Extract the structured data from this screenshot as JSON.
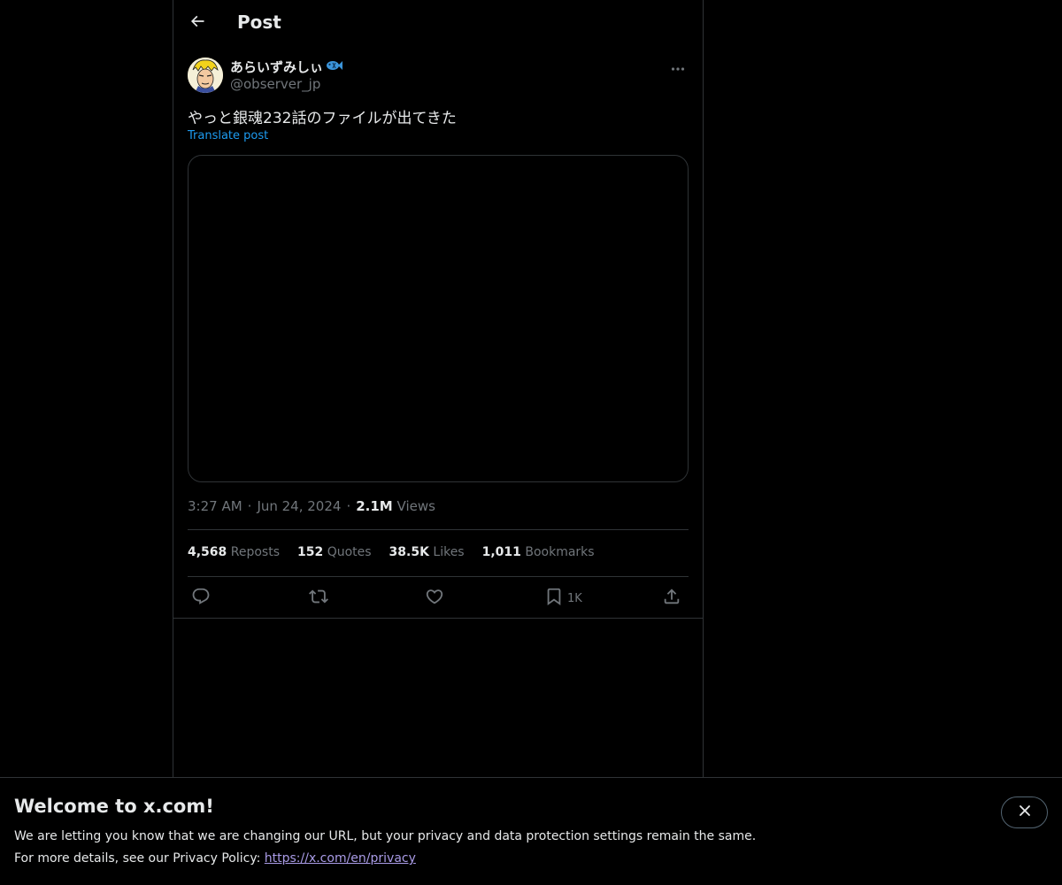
{
  "header": {
    "title": "Post",
    "back_icon": "arrow-left-icon"
  },
  "post": {
    "author": {
      "display_name": "あらいずみしぃ",
      "emoji_icon": "fish-icon",
      "handle": "@observer_jp"
    },
    "text": "やっと銀魂232話のファイルが出てきた",
    "translate_label": "Translate post",
    "time": "3:27 AM",
    "date": "Jun 24, 2024",
    "views_count": "2.1M",
    "views_label": "Views",
    "separator": "·"
  },
  "stats": {
    "reposts_count": "4,568",
    "reposts_label": "Reposts",
    "quotes_count": "152",
    "quotes_label": "Quotes",
    "likes_count": "38.5K",
    "likes_label": "Likes",
    "bookmarks_count": "1,011",
    "bookmarks_label": "Bookmarks"
  },
  "actions": {
    "reply_icon": "reply-icon",
    "repost_icon": "repost-icon",
    "like_icon": "heart-icon",
    "bookmark_icon": "bookmark-icon",
    "bookmark_count": "1K",
    "share_icon": "share-icon"
  },
  "banner": {
    "title": "Welcome to x.com!",
    "line1": "We are letting you know that we are changing our URL, but your privacy and data protection settings remain the same.",
    "line2_prefix": "For more details, see our Privacy Policy: ",
    "link": "https://x.com/en/privacy",
    "close_icon": "close-icon"
  },
  "colors": {
    "background": "#000000",
    "text": "#e7e9ea",
    "muted": "#71767b",
    "accent": "#1d9bf0",
    "border": "#2f3336",
    "link": "#a99be6"
  }
}
